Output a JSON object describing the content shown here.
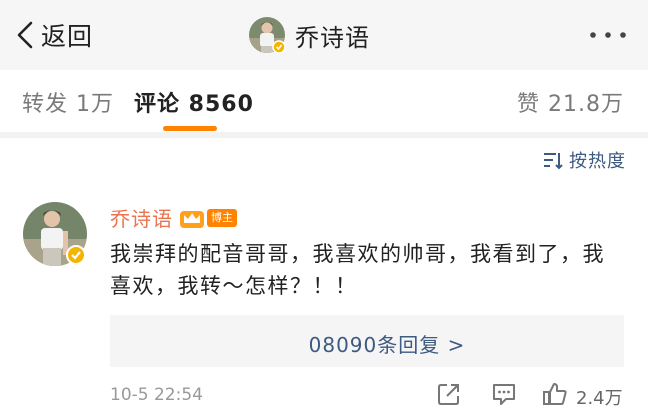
{
  "nav": {
    "back_label": "返回",
    "user_name": "乔诗语",
    "more_icon": "more-icon"
  },
  "tabs": {
    "forward": "转发 1万",
    "comments": "评论 8560",
    "likes": "赞 21.8万",
    "active": "comments"
  },
  "sort": {
    "label": "按热度",
    "icon": "sort-icon"
  },
  "comment": {
    "author": "乔诗语",
    "badge": "博主",
    "text": "我崇拜的配音哥哥，我喜欢的帅哥，我看到了，我喜欢，我转～怎样？！！",
    "replies_label": "08090条回复 >",
    "timestamp": "10-5 22:54",
    "like_count": "2.4万"
  },
  "colors": {
    "accent": "#ff8200",
    "link": "#3d5a80",
    "author": "#eb7350",
    "verified": "#f5b400"
  }
}
